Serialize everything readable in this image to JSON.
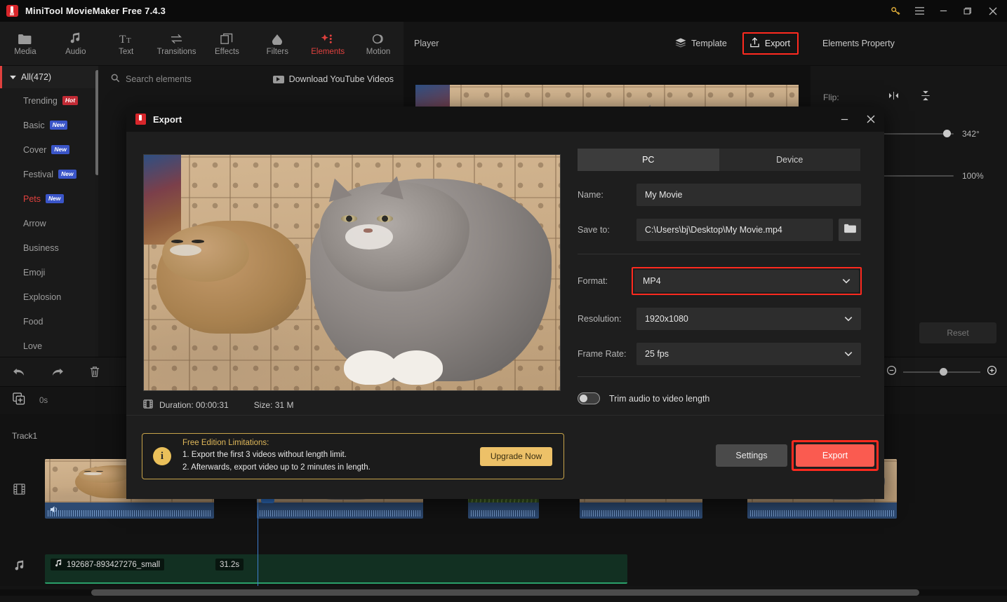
{
  "titlebar": {
    "app_title": "MiniTool MovieMaker Free 7.4.3",
    "logo_icon": "minitool-logo-icon",
    "controls": [
      {
        "name": "key-icon",
        "label": "⚿"
      },
      {
        "name": "menu-icon",
        "label": "≡"
      },
      {
        "name": "minimize-icon",
        "label": "—"
      },
      {
        "name": "maximize-icon",
        "label": "❐"
      },
      {
        "name": "close-icon",
        "label": "✕"
      }
    ]
  },
  "toolbar": {
    "items": [
      {
        "label": "Media",
        "icon": "folder-icon",
        "active": false
      },
      {
        "label": "Audio",
        "icon": "music-note-icon",
        "active": false
      },
      {
        "label": "Text",
        "icon": "text-icon",
        "active": false
      },
      {
        "label": "Transitions",
        "icon": "transitions-icon",
        "active": false
      },
      {
        "label": "Effects",
        "icon": "effects-icon",
        "active": false
      },
      {
        "label": "Filters",
        "icon": "filters-icon",
        "active": false
      },
      {
        "label": "Elements",
        "icon": "elements-icon",
        "active": true
      },
      {
        "label": "Motion",
        "icon": "motion-icon",
        "active": false
      }
    ],
    "active_color": "#e0413e"
  },
  "player_header": {
    "label": "Player",
    "template_label": "Template",
    "template_icon": "layers-icon",
    "export_label": "Export",
    "export_icon": "upload-icon",
    "export_highlight_color": "#ff2a1f"
  },
  "properties_panel": {
    "title": "Elements Property",
    "flip_label": "Flip:",
    "flip_horizontal_icon": "flip-horizontal-icon",
    "flip_vertical_icon": "flip-vertical-icon",
    "rotation_value": "342°",
    "scale_value": "100%",
    "reset_label": "Reset"
  },
  "categories": {
    "all_label": "All(472)",
    "expand_icon": "chevron-down-icon",
    "items": [
      {
        "label": "Trending",
        "badge": "Hot",
        "badge_type": "hot",
        "selected": false
      },
      {
        "label": "Basic",
        "badge": "New",
        "badge_type": "new",
        "selected": false
      },
      {
        "label": "Cover",
        "badge": "New",
        "badge_type": "new",
        "selected": false
      },
      {
        "label": "Festival",
        "badge": "New",
        "badge_type": "new",
        "selected": false
      },
      {
        "label": "Pets",
        "badge": "New",
        "badge_type": "new",
        "selected": true
      },
      {
        "label": "Arrow",
        "badge": "",
        "badge_type": "",
        "selected": false
      },
      {
        "label": "Business",
        "badge": "",
        "badge_type": "",
        "selected": false
      },
      {
        "label": "Emoji",
        "badge": "",
        "badge_type": "",
        "selected": false
      },
      {
        "label": "Explosion",
        "badge": "",
        "badge_type": "",
        "selected": false
      },
      {
        "label": "Food",
        "badge": "",
        "badge_type": "",
        "selected": false
      },
      {
        "label": "Love",
        "badge": "",
        "badge_type": "",
        "selected": false
      }
    ]
  },
  "elements_panel": {
    "search_placeholder": "Search elements",
    "search_icon": "search-icon",
    "youtube_label": "Download YouTube Videos",
    "youtube_icon": "youtube-icon"
  },
  "timeline": {
    "undo_icon": "undo-icon",
    "redo_icon": "redo-icon",
    "delete_icon": "trash-icon",
    "split_icon": "split-icon",
    "zoom_out_icon": "zoom-out-icon",
    "zoom_in_icon": "zoom-in-icon",
    "add_track_icon": "add-track-icon",
    "ruler_start": "0s",
    "track_label": "Track1",
    "video_track_icon": "film-strip-icon",
    "audio_track_icon": "music-note-icon",
    "audio_clip": {
      "name": "192687-893427276_small",
      "duration": "31.2s",
      "icon": "music-note-icon"
    },
    "video_clips": [
      {
        "muted_icon": "speaker-icon"
      },
      {
        "transition_icon": "transition-x-icon"
      },
      {},
      {},
      {}
    ]
  },
  "export_dialog": {
    "title": "Export",
    "logo_icon": "minitool-logo-icon",
    "minimize_icon": "minimize-icon",
    "close_icon": "close-icon",
    "tabs": [
      {
        "label": "PC",
        "active": true
      },
      {
        "label": "Device",
        "active": false
      }
    ],
    "fields": {
      "name_label": "Name:",
      "name_value": "My Movie",
      "save_to_label": "Save to:",
      "save_to_value": "C:\\Users\\bj\\Desktop\\My Movie.mp4",
      "browse_icon": "folder-icon",
      "format_label": "Format:",
      "format_value": "MP4",
      "format_highlighted": true,
      "resolution_label": "Resolution:",
      "resolution_value": "1920x1080",
      "frame_rate_label": "Frame Rate:",
      "frame_rate_value": "25 fps",
      "caret_icon": "chevron-down-icon"
    },
    "toggle": {
      "label": "Trim audio to video length",
      "state": "off"
    },
    "meta": {
      "icon": "film-strip-icon",
      "duration": "Duration:  00:00:31",
      "size": "Size: 31 M"
    },
    "limitations": {
      "icon": "info-icon",
      "title": "Free Edition Limitations:",
      "line1": "1. Export the first 3 videos without length limit.",
      "line2": "2. Afterwards, export video up to 2 minutes in length.",
      "upgrade_label": "Upgrade Now",
      "border_color": "#c8a44a",
      "upgrade_color": "#edc168"
    },
    "settings_label": "Settings",
    "export_label": "Export",
    "export_button_color": "#fa5b50",
    "export_highlight_color": "#ff2a1f"
  }
}
